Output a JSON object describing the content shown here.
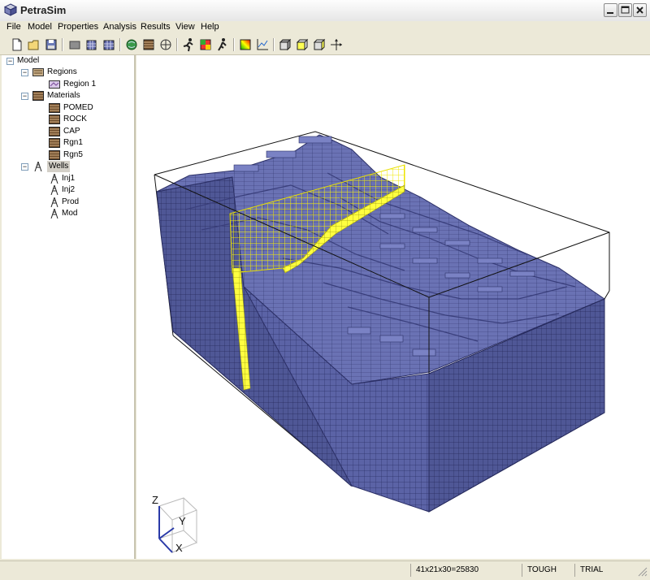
{
  "app": {
    "title": "PetraSim"
  },
  "menu": [
    "File",
    "Model",
    "Properties",
    "Analysis",
    "Results",
    "View",
    "Help"
  ],
  "toolbar": {
    "buttons": [
      "new-icon",
      "open-icon",
      "save-icon",
      "cell-icon",
      "grid-refine-icon",
      "grid-icon",
      "globe-icon",
      "material-icon",
      "rotate-icon",
      "run-icon",
      "pen-icon",
      "walk-icon",
      "color-scale-icon",
      "plot-icon",
      "view-top-icon",
      "view-front-icon",
      "view-side-icon",
      "axes-icon"
    ]
  },
  "tree": {
    "root": "Model",
    "regions": {
      "label": "Regions",
      "items": [
        "Region 1"
      ]
    },
    "materials": {
      "label": "Materials",
      "items": [
        "POMED",
        "ROCK",
        "CAP",
        "Rgn1",
        "Rgn5"
      ]
    },
    "wells": {
      "label": "Wells",
      "items": [
        "Inj1",
        "Inj2",
        "Prod",
        "Mod"
      ]
    }
  },
  "axes": {
    "z": "Z",
    "y": "Y",
    "x": "X"
  },
  "status": {
    "grid": "41x21x30=25830",
    "simulator": "TOUGH",
    "license": "TRIAL"
  },
  "colors": {
    "mesh": "#5b63a6",
    "mesh_edge": "#2b2f66",
    "well_highlight": "#ffff40"
  }
}
